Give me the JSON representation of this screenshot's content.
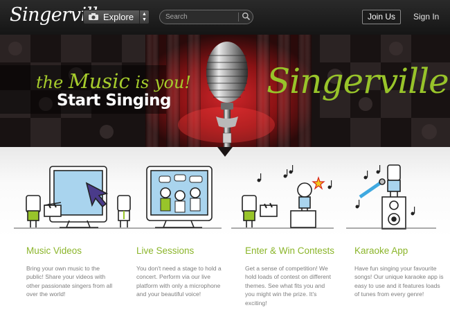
{
  "header": {
    "logo": "Singerville",
    "explore_label": "Explore",
    "explore_icon": "camera-icon",
    "search_placeholder": "Search",
    "join_label": "Join Us",
    "signin_label": "Sign In"
  },
  "hero": {
    "tagline_pre": "the ",
    "tagline_music": "Music",
    "tagline_post": " is you!",
    "start": "Start Singing",
    "logo": "Singerville"
  },
  "features": [
    {
      "title": "Music Videos",
      "text": "Bring your own music to the public! Share your videos with other passionate singers from all over the world!"
    },
    {
      "title": "Live Sessions",
      "text": "You don't need a stage to hold a concert. Perform via our live platform with only a microphone and your beautiful voice!"
    },
    {
      "title": "Enter & Win Contests",
      "text": "Get a sense of competition! We hold loads of contest on different themes. See what fits you and you might win the prize. It's exciting!"
    },
    {
      "title": "Karaoke App",
      "text": "Have fun singing your favourite songs! Our unique karaoke app is easy to use and it features loads of tunes from every genre!"
    }
  ],
  "colors": {
    "brand_green": "#8bb52a",
    "header_bg": "#1f1f1f",
    "hero_red": "#b0171a"
  }
}
